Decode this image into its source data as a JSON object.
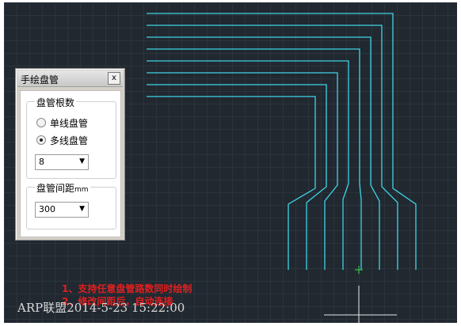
{
  "dialog": {
    "title": "手绘盘管",
    "close_glyph": "x",
    "count_group": {
      "legend": "盘管根数",
      "options": [
        {
          "label": "单线盘管",
          "selected": false
        },
        {
          "label": "多线盘管",
          "selected": true
        }
      ],
      "count_value": "8"
    },
    "spacing_group": {
      "legend": "盘管间距",
      "legend_unit": "mm",
      "spacing_value": "300"
    }
  },
  "notes": {
    "line1": "1、支持任意盘管路数同时绘制",
    "line2": "2、修改间距后，自动连接"
  },
  "watermark": "ARP联盟2014-5-23 15:22:00",
  "colors": {
    "canvas_bg": "#212830",
    "pipe": "#3fd4e6",
    "note_text": "#e02020",
    "cursor": "#35c24a"
  }
}
